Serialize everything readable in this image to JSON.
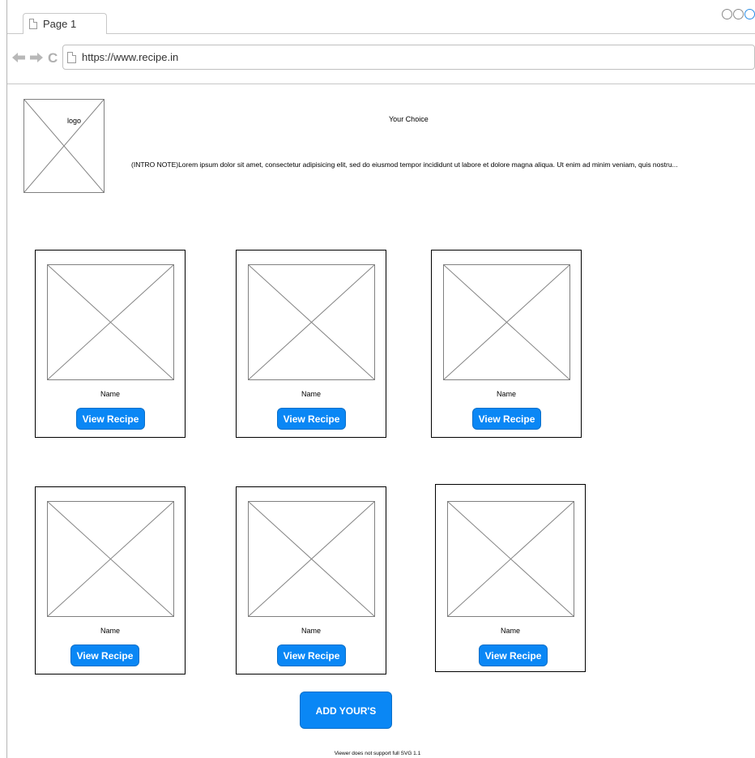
{
  "browser": {
    "tab_label": "Page 1",
    "url": "https://www.recipe.in",
    "colors": {
      "border": "#c8c8c8",
      "accent": "#2b8ee6"
    }
  },
  "page": {
    "logo_label": "logo",
    "site_title": "Your Choice",
    "intro_note": "(INTRO NOTE)Lorem ipsum dolor sit amet, consectetur adipisicing elit, sed do eiusmod tempor incididunt ut labore et dolore magna aliqua. Ut enim ad minim veniam, quis nostru...",
    "cards": [
      {
        "name": "Name",
        "button_label": "View Recipe"
      },
      {
        "name": "Name",
        "button_label": "View Recipe"
      },
      {
        "name": "Name",
        "button_label": "View Recipe"
      },
      {
        "name": "Name",
        "button_label": "View Recipe"
      },
      {
        "name": "Name",
        "button_label": "View Recipe"
      },
      {
        "name": "Name",
        "button_label": "View Recipe"
      }
    ],
    "add_button_label": "ADD YOUR'S",
    "footer_note": "Viewer does not support full SVG 1.1",
    "colors": {
      "button": "#0a87f5",
      "button_text": "#ffffff"
    }
  }
}
